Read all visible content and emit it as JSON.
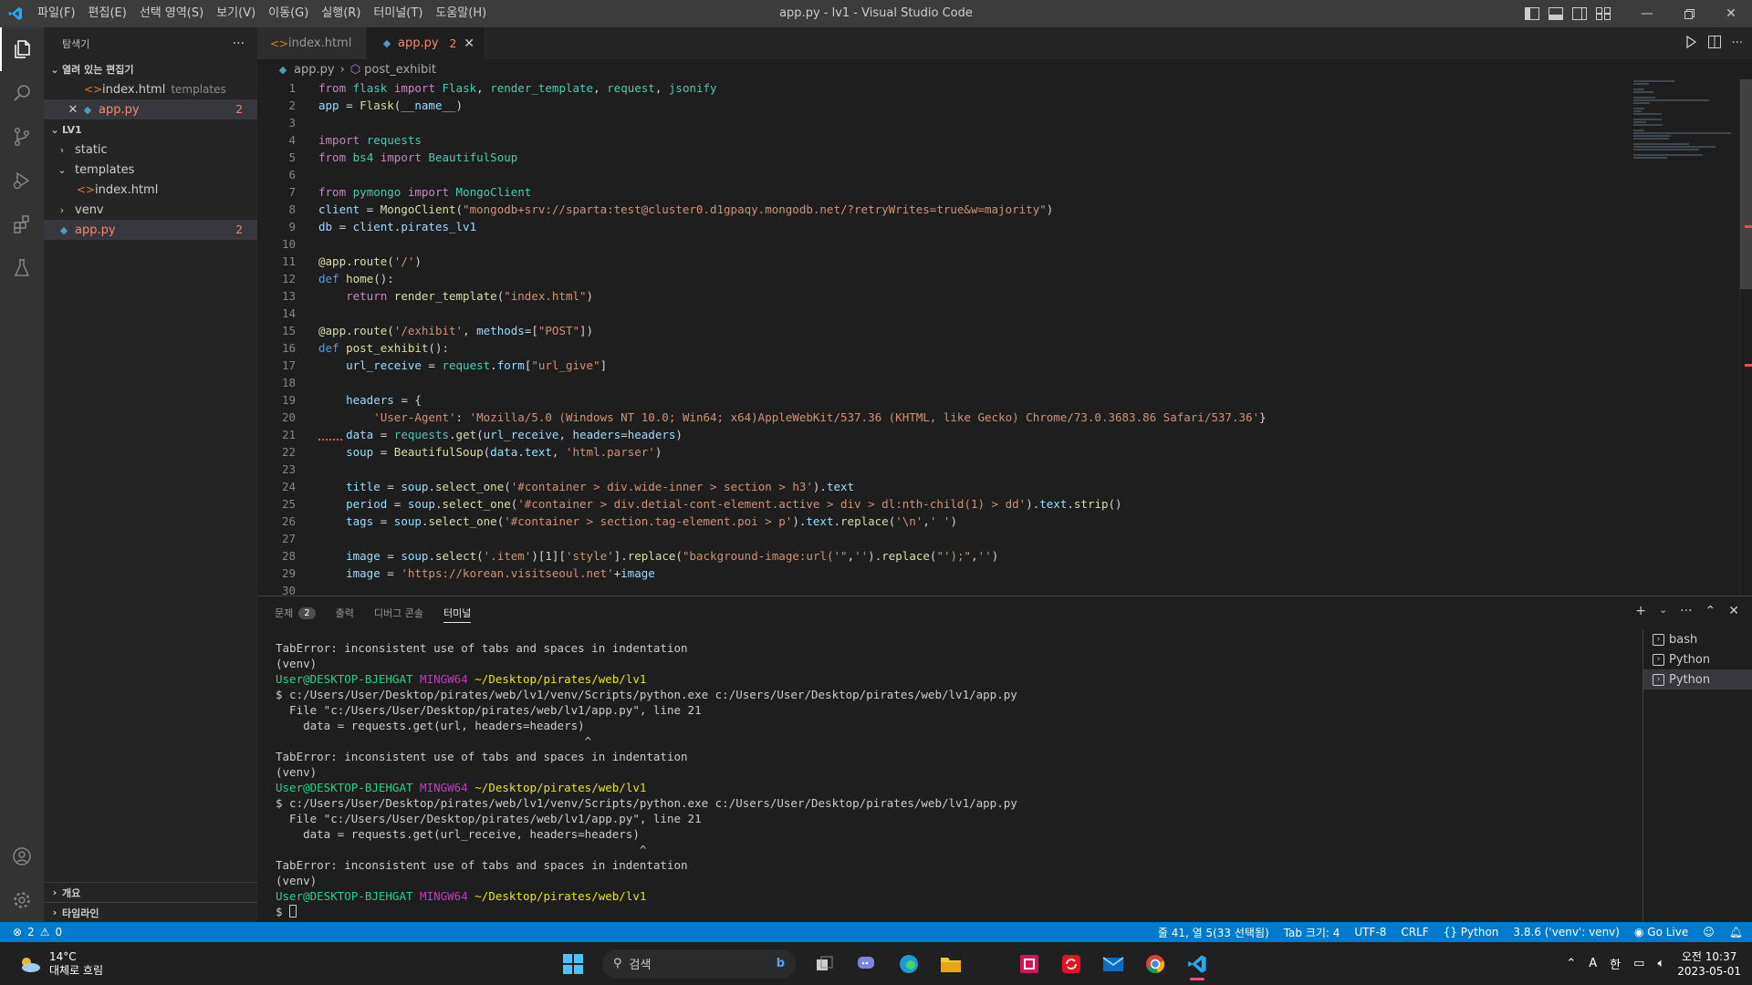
{
  "window": {
    "title": "app.py - lv1 - Visual Studio Code",
    "menu": [
      "파일(F)",
      "편집(E)",
      "선택 영역(S)",
      "보기(V)",
      "이동(G)",
      "실행(R)",
      "터미널(T)",
      "도움말(H)"
    ]
  },
  "sidebar": {
    "title": "탐색기",
    "open_editors_label": "열려 있는 편집기",
    "open_editors": [
      {
        "name": "index.html",
        "desc": "templates"
      },
      {
        "name": "app.py",
        "badge": "2"
      }
    ],
    "workspace_label": "LV1",
    "tree": [
      {
        "name": "static"
      },
      {
        "name": "templates"
      },
      {
        "name": "index.html"
      },
      {
        "name": "venv"
      },
      {
        "name": "app.py",
        "badge": "2"
      }
    ],
    "outline_label": "개요",
    "timeline_label": "타임라인"
  },
  "tabs": [
    {
      "label": "index.html"
    },
    {
      "label": "app.py",
      "badge": "2"
    }
  ],
  "breadcrumb": [
    "app.py",
    "post_exhibit"
  ],
  "editor": {
    "lines": [
      {
        "n": "1",
        "t": "from flask import Flask, render_template, request, jsonify"
      },
      {
        "n": "2",
        "t": "app = Flask(__name__)"
      },
      {
        "n": "3",
        "t": ""
      },
      {
        "n": "4",
        "t": "import requests"
      },
      {
        "n": "5",
        "t": "from bs4 import BeautifulSoup"
      },
      {
        "n": "6",
        "t": ""
      },
      {
        "n": "7",
        "t": "from pymongo import MongoClient"
      },
      {
        "n": "8",
        "t": "client = MongoClient(\"mongodb+srv://sparta:test@cluster0.d1gpaqy.mongodb.net/?retryWrites=true&w=majority\")"
      },
      {
        "n": "9",
        "t": "db = client.pirates_lv1"
      },
      {
        "n": "10",
        "t": ""
      },
      {
        "n": "11",
        "t": "@app.route('/')"
      },
      {
        "n": "12",
        "t": "def home():"
      },
      {
        "n": "13",
        "t": "    return render_template(\"index.html\")"
      },
      {
        "n": "14",
        "t": ""
      },
      {
        "n": "15",
        "t": "@app.route('/exhibit', methods=[\"POST\"])"
      },
      {
        "n": "16",
        "t": "def post_exhibit():"
      },
      {
        "n": "17",
        "t": "    url_receive = request.form[\"url_give\"]"
      },
      {
        "n": "18",
        "t": ""
      },
      {
        "n": "19",
        "t": "    headers = {"
      },
      {
        "n": "20",
        "t": "        'User-Agent': 'Mozilla/5.0 (Windows NT 10.0; Win64; x64)AppleWebKit/537.36 (KHTML, like Gecko) Chrome/73.0.3683.86 Safari/537.36'}"
      },
      {
        "n": "21",
        "t": "    data = requests.get(url_receive, headers=headers)"
      },
      {
        "n": "22",
        "t": "    soup = BeautifulSoup(data.text, 'html.parser')"
      },
      {
        "n": "23",
        "t": ""
      },
      {
        "n": "24",
        "t": "    title = soup.select_one('#container > div.wide-inner > section > h3').text"
      },
      {
        "n": "25",
        "t": "    period = soup.select_one('#container > div.detial-cont-element.active > div > dl:nth-child(1) > dd').text.strip()"
      },
      {
        "n": "26",
        "t": "    tags = soup.select_one('#container > section.tag-element.poi > p').text.replace('\\n',' ')"
      },
      {
        "n": "27",
        "t": ""
      },
      {
        "n": "28",
        "t": "    image = soup.select('.item')[1]['style'].replace(\"background-image:url('\",'').replace(\"');\",'')"
      },
      {
        "n": "29",
        "t": "    image = 'https://korean.visitseoul.net'+image"
      },
      {
        "n": "30",
        "t": ""
      }
    ]
  },
  "panel": {
    "tabs": [
      {
        "label": "문제",
        "badge": "2"
      },
      {
        "label": "출력"
      },
      {
        "label": "디버그 콘솔"
      },
      {
        "label": "터미널"
      }
    ],
    "terminal_lines": [
      {
        "kind": "text",
        "t": "TabError: inconsistent use of tabs and spaces in indentation"
      },
      {
        "kind": "text",
        "t": "(venv)"
      },
      {
        "kind": "prompt",
        "user": "User@DESKTOP-BJEHGAT",
        "ming": "MINGW64",
        "path": "~/Desktop/pirates/web/lv1"
      },
      {
        "kind": "text",
        "t": "$ c:/Users/User/Desktop/pirates/web/lv1/venv/Scripts/python.exe c:/Users/User/Desktop/pirates/web/lv1/app.py"
      },
      {
        "kind": "text",
        "t": "  File \"c:/Users/User/Desktop/pirates/web/lv1/app.py\", line 21"
      },
      {
        "kind": "text",
        "t": "    data = requests.get(url, headers=headers)"
      },
      {
        "kind": "text",
        "t": "                                             ^"
      },
      {
        "kind": "text",
        "t": "TabError: inconsistent use of tabs and spaces in indentation"
      },
      {
        "kind": "text",
        "t": "(venv)"
      },
      {
        "kind": "prompt",
        "user": "User@DESKTOP-BJEHGAT",
        "ming": "MINGW64",
        "path": "~/Desktop/pirates/web/lv1"
      },
      {
        "kind": "text",
        "t": "$ c:/Users/User/Desktop/pirates/web/lv1/venv/Scripts/python.exe c:/Users/User/Desktop/pirates/web/lv1/app.py"
      },
      {
        "kind": "text",
        "t": "  File \"c:/Users/User/Desktop/pirates/web/lv1/app.py\", line 21"
      },
      {
        "kind": "text",
        "t": "    data = requests.get(url_receive, headers=headers)"
      },
      {
        "kind": "text",
        "t": "                                                     ^"
      },
      {
        "kind": "text",
        "t": "TabError: inconsistent use of tabs and spaces in indentation"
      },
      {
        "kind": "text",
        "t": "(venv)"
      },
      {
        "kind": "prompt",
        "user": "User@DESKTOP-BJEHGAT",
        "ming": "MINGW64",
        "path": "~/Desktop/pirates/web/lv1"
      },
      {
        "kind": "input",
        "t": "$ "
      }
    ],
    "terminals": [
      "bash",
      "Python",
      "Python"
    ]
  },
  "statusbar": {
    "errors": "2",
    "warnings": "0",
    "position": "줄 41, 열 5(33 선택됨)",
    "tab_size": "Tab 크기: 4",
    "encoding": "UTF-8",
    "eol": "CRLF",
    "language": "Python",
    "interpreter": "3.8.6 ('venv': venv)",
    "golive": "Go Live"
  },
  "taskbar": {
    "temp": "14°C",
    "weather": "대체로 흐림",
    "search": "검색",
    "ime": "A",
    "lang": "한",
    "time": "오전 10:37",
    "date": "2023-05-01"
  },
  "colors": {
    "statusbar": "#007acc",
    "keyword": "#c586c0",
    "function": "#dcdcaa",
    "string": "#ce9178",
    "error": "#f48771"
  }
}
